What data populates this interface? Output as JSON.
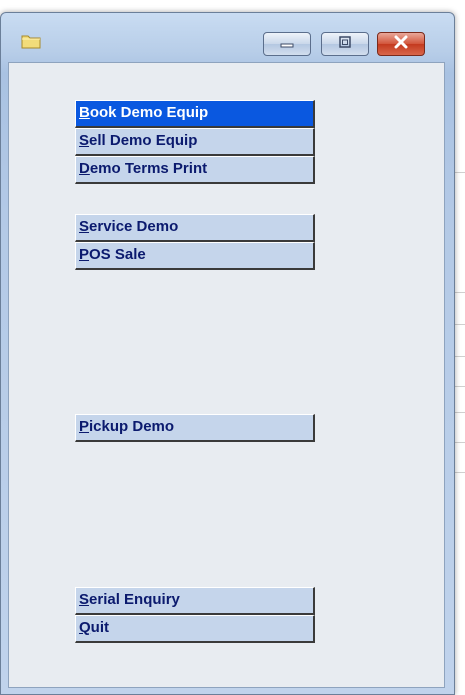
{
  "window": {
    "icon": "folder-icon",
    "controls": {
      "minimize": "minimize-icon",
      "maximize": "maximize-icon",
      "close": "close-icon"
    }
  },
  "menu": {
    "items": [
      {
        "accel": "B",
        "rest": "ook Demo Equip",
        "active": true
      },
      {
        "accel": "S",
        "rest": "ell Demo Equip",
        "active": false
      },
      {
        "accel": "D",
        "rest": "emo Terms Print",
        "active": false
      },
      {
        "accel": "S",
        "rest": "ervice Demo",
        "active": false
      },
      {
        "accel": "P",
        "rest": "OS Sale",
        "active": false
      },
      {
        "accel": "P",
        "rest": "ickup Demo",
        "active": false
      },
      {
        "accel": "S",
        "rest": "erial Enquiry",
        "active": false
      },
      {
        "accel": "Q",
        "rest": "uit",
        "active": false
      }
    ]
  },
  "colors": {
    "active_button": "#0a58e0",
    "button_face": "#c5d5eb",
    "button_text": "#0b1a6e"
  }
}
